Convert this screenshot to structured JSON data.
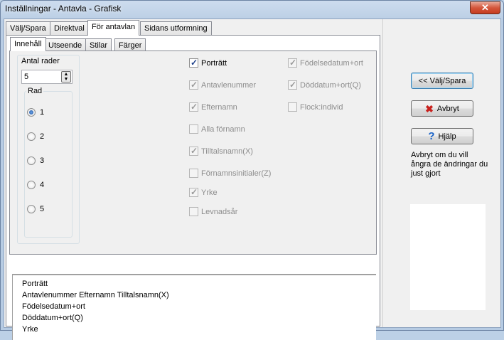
{
  "window": {
    "title": "Inställningar - Antavla - Grafisk",
    "close_label": "✕"
  },
  "tabs": [
    "Välj/Spara",
    "Direktval",
    "För antavlan",
    "Sidans utformning"
  ],
  "subtabs": [
    "Innehåll",
    "Utseende",
    "Stilar",
    "Färger"
  ],
  "rows": {
    "label": "Antal rader",
    "value": "5",
    "group_label": "Rad",
    "options": [
      "1",
      "2",
      "3",
      "4",
      "5"
    ],
    "selected": "1"
  },
  "checkboxes": {
    "col1": [
      {
        "label": "Porträtt",
        "checked": true,
        "enabled": true
      },
      {
        "label": "Antavlenummer",
        "checked": true,
        "enabled": false
      },
      {
        "label": "Efternamn",
        "checked": true,
        "enabled": false
      },
      {
        "label": "Alla förnamn",
        "checked": false,
        "enabled": false
      },
      {
        "label": "Tilltalsnamn(X)",
        "checked": true,
        "enabled": false
      },
      {
        "label": "Förnamnsinitialer(Z)",
        "checked": false,
        "enabled": false
      },
      {
        "label": "Yrke",
        "checked": true,
        "enabled": false
      },
      {
        "label": "Levnadsår",
        "checked": false,
        "enabled": false
      }
    ],
    "col2": [
      {
        "label": "Födelsedatum+ort",
        "checked": true,
        "enabled": false
      },
      {
        "label": "Döddatum+ort(Q)",
        "checked": true,
        "enabled": false
      },
      {
        "label": "Flock:individ",
        "checked": false,
        "enabled": false
      }
    ]
  },
  "summary": {
    "lines": [
      "Porträtt",
      "Antavlenummer Efternamn Tilltalsnamn(X)",
      "Födelsedatum+ort",
      "Döddatum+ort(Q)",
      "Yrke"
    ]
  },
  "buttons": {
    "back": "<< Välj/Spara",
    "cancel": "Avbryt",
    "help": "Hjälp"
  },
  "hint": "Avbryt om du vill ångra de ändringar du just gjort"
}
